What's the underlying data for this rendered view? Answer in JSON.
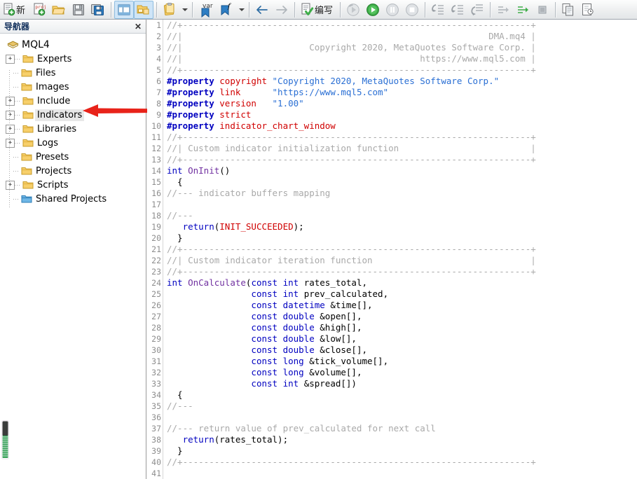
{
  "toolbar": {
    "items": [
      {
        "name": "new-file-button",
        "icon": "new-file-icon",
        "label": "新",
        "type": "button"
      },
      {
        "name": "new-project-button",
        "icon": "new-project-icon",
        "label": "",
        "type": "button"
      },
      {
        "name": "open-button",
        "icon": "open-folder-icon",
        "label": "",
        "type": "button"
      },
      {
        "name": "save-button",
        "icon": "save-floppy-icon",
        "label": "",
        "type": "button"
      },
      {
        "name": "save-all-button",
        "icon": "save-all-icon",
        "label": "",
        "type": "button"
      },
      {
        "name": "toggle-navigator-button",
        "icon": "panel-layout-icon",
        "label": "",
        "type": "toggle",
        "pressed": true
      },
      {
        "name": "toggle-toolbox-button",
        "icon": "folder-panel-icon",
        "label": "",
        "type": "toggle",
        "pressed": true
      },
      {
        "name": "clipboard-button",
        "icon": "clipboard-icon",
        "label": "",
        "type": "split"
      },
      {
        "name": "variables-button",
        "icon": "var-bookmark-icon",
        "label": "var",
        "type": "button"
      },
      {
        "name": "functions-button",
        "icon": "function-bookmark-icon",
        "label": "f",
        "type": "split"
      },
      {
        "name": "back-button",
        "icon": "arrow-left-icon",
        "label": "",
        "type": "button"
      },
      {
        "name": "forward-button",
        "icon": "arrow-right-icon",
        "label": "",
        "type": "button",
        "disabled": true
      },
      {
        "name": "compile-button",
        "icon": "compile-check-icon",
        "label": "编写",
        "type": "button"
      },
      {
        "name": "restart-button",
        "icon": "restart-icon",
        "label": "",
        "type": "button",
        "disabled": true
      },
      {
        "name": "start-button",
        "icon": "play-green-icon",
        "label": "",
        "type": "button"
      },
      {
        "name": "pause-button",
        "icon": "pause-icon",
        "label": "",
        "type": "button",
        "disabled": true
      },
      {
        "name": "stop-button",
        "icon": "stop-icon",
        "label": "",
        "type": "button",
        "disabled": true
      },
      {
        "name": "step-into-button",
        "icon": "step-into-icon",
        "label": "",
        "type": "button",
        "disabled": true
      },
      {
        "name": "step-over-button",
        "icon": "step-over-icon",
        "label": "",
        "type": "button",
        "disabled": true
      },
      {
        "name": "step-out-button",
        "icon": "step-out-icon",
        "label": "",
        "type": "button",
        "disabled": true
      },
      {
        "name": "run-to-cursor-button",
        "icon": "run-to-cursor-icon",
        "label": "",
        "type": "button",
        "disabled": true
      },
      {
        "name": "resume-button",
        "icon": "resume-green-icon",
        "label": "",
        "type": "button"
      },
      {
        "name": "breakpoint-button",
        "icon": "breakpoint-square-icon",
        "label": "",
        "type": "button",
        "disabled": true
      },
      {
        "name": "copy-button",
        "icon": "copy-pages-icon",
        "label": "",
        "type": "button"
      },
      {
        "name": "properties-button",
        "icon": "document-properties-icon",
        "label": "",
        "type": "button"
      }
    ]
  },
  "navigator": {
    "title": "导航器",
    "close_label": "✕",
    "root": {
      "label": "MQL4",
      "icon": "mql-package-icon"
    },
    "items": [
      {
        "label": "Experts",
        "expandable": true,
        "icon": "folder-icon",
        "selected": false
      },
      {
        "label": "Files",
        "expandable": false,
        "icon": "folder-icon",
        "selected": false
      },
      {
        "label": "Images",
        "expandable": false,
        "icon": "folder-icon",
        "selected": false
      },
      {
        "label": "Include",
        "expandable": true,
        "icon": "folder-icon",
        "selected": false
      },
      {
        "label": "Indicators",
        "expandable": true,
        "icon": "folder-icon",
        "selected": true
      },
      {
        "label": "Libraries",
        "expandable": true,
        "icon": "folder-icon",
        "selected": false
      },
      {
        "label": "Logs",
        "expandable": true,
        "icon": "folder-icon",
        "selected": false
      },
      {
        "label": "Presets",
        "expandable": false,
        "icon": "folder-icon",
        "selected": false
      },
      {
        "label": "Projects",
        "expandable": false,
        "icon": "folder-icon",
        "selected": false
      },
      {
        "label": "Scripts",
        "expandable": true,
        "icon": "folder-icon",
        "selected": false
      },
      {
        "label": "Shared Projects",
        "expandable": false,
        "icon": "folder-shared-icon",
        "selected": false
      }
    ]
  },
  "annotation": {
    "arrow_color": "#e8231a",
    "points_to": "Indicators"
  },
  "editor": {
    "file_name": "DMA.mq4",
    "copyright": "Copyright 2020, MetaQuotes Software Corp.",
    "link": "https://www.mql5.com",
    "version": "1.00",
    "first_line": 1,
    "last_line": 41,
    "lines": [
      {
        "n": 1,
        "tokens": [
          {
            "c": "cmt",
            "t": "//+------------------------------------------------------------------+"
          }
        ]
      },
      {
        "n": 2,
        "tokens": [
          {
            "c": "cmt",
            "t": "//|                                                          DMA.mq4 |"
          }
        ]
      },
      {
        "n": 3,
        "tokens": [
          {
            "c": "cmt",
            "t": "//|                        Copyright 2020, MetaQuotes Software Corp. |"
          }
        ]
      },
      {
        "n": 4,
        "tokens": [
          {
            "c": "cmt",
            "t": "//|                                             https://www.mql5.com |"
          }
        ]
      },
      {
        "n": 5,
        "tokens": [
          {
            "c": "cmt",
            "t": "//+------------------------------------------------------------------+"
          }
        ]
      },
      {
        "n": 6,
        "tokens": [
          {
            "c": "prop",
            "t": "#property "
          },
          {
            "c": "propname",
            "t": "copyright "
          },
          {
            "c": "str",
            "t": "\"Copyright 2020, MetaQuotes Software Corp.\""
          }
        ]
      },
      {
        "n": 7,
        "tokens": [
          {
            "c": "prop",
            "t": "#property "
          },
          {
            "c": "propname",
            "t": "link      "
          },
          {
            "c": "str",
            "t": "\"https://www.mql5.com\""
          }
        ]
      },
      {
        "n": 8,
        "tokens": [
          {
            "c": "prop",
            "t": "#property "
          },
          {
            "c": "propname",
            "t": "version   "
          },
          {
            "c": "str",
            "t": "\"1.00\""
          }
        ]
      },
      {
        "n": 9,
        "tokens": [
          {
            "c": "prop",
            "t": "#property "
          },
          {
            "c": "propname",
            "t": "strict"
          }
        ]
      },
      {
        "n": 10,
        "tokens": [
          {
            "c": "prop",
            "t": "#property "
          },
          {
            "c": "propname",
            "t": "indicator_chart_window"
          }
        ]
      },
      {
        "n": 11,
        "tokens": [
          {
            "c": "cmt",
            "t": "//+------------------------------------------------------------------+"
          }
        ]
      },
      {
        "n": 12,
        "tokens": [
          {
            "c": "cmt",
            "t": "//| Custom indicator initialization function                         |"
          }
        ]
      },
      {
        "n": 13,
        "tokens": [
          {
            "c": "cmt",
            "t": "//+------------------------------------------------------------------+"
          }
        ]
      },
      {
        "n": 14,
        "tokens": [
          {
            "c": "kw",
            "t": "int "
          },
          {
            "c": "fn",
            "t": "OnInit"
          },
          {
            "c": "pln",
            "t": "()"
          }
        ]
      },
      {
        "n": 15,
        "tokens": [
          {
            "c": "pln",
            "t": "  {"
          }
        ]
      },
      {
        "n": 16,
        "tokens": [
          {
            "c": "cmt",
            "t": "//--- indicator buffers mapping"
          }
        ]
      },
      {
        "n": 17,
        "tokens": [
          {
            "c": "pln",
            "t": ""
          }
        ]
      },
      {
        "n": 18,
        "tokens": [
          {
            "c": "cmt",
            "t": "//---"
          }
        ]
      },
      {
        "n": 19,
        "tokens": [
          {
            "c": "pln",
            "t": "   "
          },
          {
            "c": "kw",
            "t": "return"
          },
          {
            "c": "pln",
            "t": "("
          },
          {
            "c": "con",
            "t": "INIT_SUCCEEDED"
          },
          {
            "c": "pln",
            "t": ");"
          }
        ]
      },
      {
        "n": 20,
        "tokens": [
          {
            "c": "pln",
            "t": "  }"
          }
        ]
      },
      {
        "n": 21,
        "tokens": [
          {
            "c": "cmt",
            "t": "//+------------------------------------------------------------------+"
          }
        ]
      },
      {
        "n": 22,
        "tokens": [
          {
            "c": "cmt",
            "t": "//| Custom indicator iteration function                              |"
          }
        ]
      },
      {
        "n": 23,
        "tokens": [
          {
            "c": "cmt",
            "t": "//+------------------------------------------------------------------+"
          }
        ]
      },
      {
        "n": 24,
        "tokens": [
          {
            "c": "kw",
            "t": "int "
          },
          {
            "c": "fn",
            "t": "OnCalculate"
          },
          {
            "c": "pln",
            "t": "("
          },
          {
            "c": "kw",
            "t": "const int "
          },
          {
            "c": "pln",
            "t": "rates_total,"
          }
        ]
      },
      {
        "n": 25,
        "tokens": [
          {
            "c": "pln",
            "t": "                "
          },
          {
            "c": "kw",
            "t": "const int "
          },
          {
            "c": "pln",
            "t": "prev_calculated,"
          }
        ]
      },
      {
        "n": 26,
        "tokens": [
          {
            "c": "pln",
            "t": "                "
          },
          {
            "c": "kw",
            "t": "const datetime "
          },
          {
            "c": "pln",
            "t": "&time[],"
          }
        ]
      },
      {
        "n": 27,
        "tokens": [
          {
            "c": "pln",
            "t": "                "
          },
          {
            "c": "kw",
            "t": "const double "
          },
          {
            "c": "pln",
            "t": "&open[],"
          }
        ]
      },
      {
        "n": 28,
        "tokens": [
          {
            "c": "pln",
            "t": "                "
          },
          {
            "c": "kw",
            "t": "const double "
          },
          {
            "c": "pln",
            "t": "&high[],"
          }
        ]
      },
      {
        "n": 29,
        "tokens": [
          {
            "c": "pln",
            "t": "                "
          },
          {
            "c": "kw",
            "t": "const double "
          },
          {
            "c": "pln",
            "t": "&low[],"
          }
        ]
      },
      {
        "n": 30,
        "tokens": [
          {
            "c": "pln",
            "t": "                "
          },
          {
            "c": "kw",
            "t": "const double "
          },
          {
            "c": "pln",
            "t": "&close[],"
          }
        ]
      },
      {
        "n": 31,
        "tokens": [
          {
            "c": "pln",
            "t": "                "
          },
          {
            "c": "kw",
            "t": "const long "
          },
          {
            "c": "pln",
            "t": "&tick_volume[],"
          }
        ]
      },
      {
        "n": 32,
        "tokens": [
          {
            "c": "pln",
            "t": "                "
          },
          {
            "c": "kw",
            "t": "const long "
          },
          {
            "c": "pln",
            "t": "&volume[],"
          }
        ]
      },
      {
        "n": 33,
        "tokens": [
          {
            "c": "pln",
            "t": "                "
          },
          {
            "c": "kw",
            "t": "const int "
          },
          {
            "c": "pln",
            "t": "&spread[])"
          }
        ]
      },
      {
        "n": 34,
        "tokens": [
          {
            "c": "pln",
            "t": "  {"
          }
        ]
      },
      {
        "n": 35,
        "tokens": [
          {
            "c": "cmt",
            "t": "//---"
          }
        ]
      },
      {
        "n": 36,
        "tokens": [
          {
            "c": "pln",
            "t": ""
          }
        ]
      },
      {
        "n": 37,
        "tokens": [
          {
            "c": "cmt",
            "t": "//--- return value of prev_calculated for next call"
          }
        ]
      },
      {
        "n": 38,
        "tokens": [
          {
            "c": "pln",
            "t": "   "
          },
          {
            "c": "kw",
            "t": "return"
          },
          {
            "c": "pln",
            "t": "(rates_total);"
          }
        ]
      },
      {
        "n": 39,
        "tokens": [
          {
            "c": "pln",
            "t": "  }"
          }
        ]
      },
      {
        "n": 40,
        "tokens": [
          {
            "c": "cmt",
            "t": "//+------------------------------------------------------------------+"
          }
        ]
      },
      {
        "n": 41,
        "tokens": [
          {
            "c": "pln",
            "t": ""
          }
        ]
      }
    ]
  },
  "colors": {
    "comment": "#a9a9a9",
    "preprocessor": "#0000c0",
    "property_name": "#d00000",
    "string": "#2a6fd4",
    "keyword": "#0000c0",
    "function": "#7030a0",
    "constant": "#d00000",
    "arrow": "#e8231a",
    "nav_title": "#12305c"
  }
}
